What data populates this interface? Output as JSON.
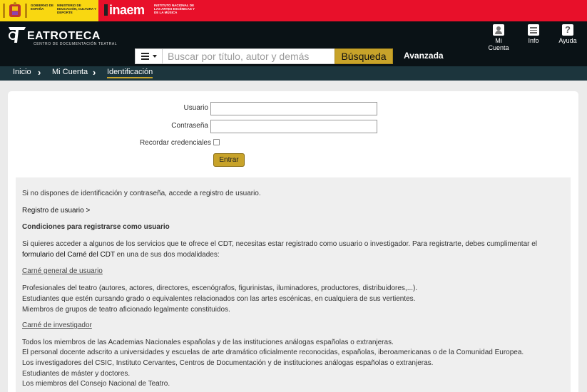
{
  "gov": {
    "gobierno": "GOBIERNO DE ESPAÑA",
    "ministerio": "MINISTERIO DE EDUCACIÓN, CULTURA Y DEPORTE",
    "inaem": "inaem",
    "inaem_sub": "INSTITUTO NACIONAL DE LAS ARTES ESCÉNICAS Y DE LA MÚSICA"
  },
  "header": {
    "logo": "EATROTECA",
    "logo_sub": "CENTRO DE DOCUMENTACIÓN TEATRAL",
    "icons": {
      "account": "Mi Cuenta",
      "info": "Info",
      "help": "Ayuda"
    }
  },
  "search": {
    "placeholder": "Buscar por título, autor y demás",
    "button": "Búsqueda",
    "advanced": "Avanzada"
  },
  "breadcrumb": [
    "Inicio",
    "Mi Cuenta",
    "Identificación"
  ],
  "form": {
    "user_label": "Usuario",
    "password_label": "Contraseña",
    "remember_label": "Recordar credenciales",
    "submit": "Entrar"
  },
  "info": {
    "intro": "Si no dispones de identificación y contraseña, accede a registro de usuario.",
    "register_link": "Registro de usuario >",
    "conditions_title": "Condiciones para registrarse como usuario",
    "conditions_p1": "Si quieres acceder a algunos de los servicios que te ofrece el CDT, necesitas estar registrado como usuario o investigador. Para registrarte, debes cumplimentar el",
    "conditions_p2_link": "formulario del Carné del CDT",
    "conditions_p2_rest": " en una de sus dos modalidades:",
    "general_title": "Carné general de usuario",
    "general_items": [
      "Profesionales del teatro (autores, actores, directores, escenógrafos, figurinistas, iluminadores, productores, distribuidores,...).",
      "Estudiantes que estén cursando grado o equivalentes relacionados con las artes escénicas, en cualquiera de sus vertientes.",
      "Miembros de grupos de teatro aficionado legalmente constituidos."
    ],
    "investigador_title": "Carné de investigador",
    "investigador_items": [
      "Todos los miembros de las Academias Nacionales españolas y de las instituciones análogas españolas o extranjeras.",
      "El personal docente adscrito a universidades y escuelas de arte dramático oficialmente reconocidas, españolas, iberoamericanas o de la Comunidad Europea.",
      "Los investigadores del CSIC, Instituto Cervantes, Centros de Documentación y de instituciones análogas españolas o extranjeras.",
      "Estudiantes de máster y doctores.",
      "Los miembros del Consejo Nacional de Teatro."
    ]
  },
  "colors": {
    "gov_red": "#e8102a",
    "gov_yellow": "#f9d711",
    "header_bg": "#0a1216",
    "breadcrumb_bg": "#1c353d",
    "accent_gold": "#c8a32a"
  }
}
